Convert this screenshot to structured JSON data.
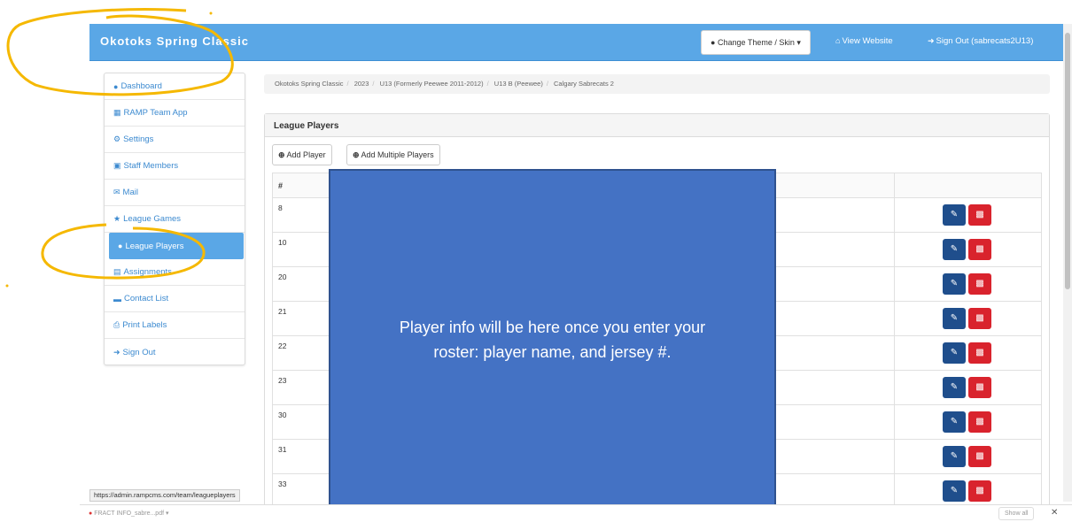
{
  "header": {
    "brand": "Okotoks Spring Classic",
    "theme_button": "Change Theme / Skin",
    "view_website": "View Website",
    "sign_out": "Sign Out (sabrecats2U13)"
  },
  "sidebar": {
    "items": [
      {
        "label": "Dashboard",
        "icon": "user-icon"
      },
      {
        "label": "RAMP Team App",
        "icon": "grid-icon"
      },
      {
        "label": "Settings",
        "icon": "gear-icon"
      },
      {
        "label": "Staff Members",
        "icon": "briefcase-icon"
      },
      {
        "label": "Mail",
        "icon": "envelope-icon"
      },
      {
        "label": "League Games",
        "icon": "star-icon"
      },
      {
        "label": "League Players",
        "icon": "user-icon"
      },
      {
        "label": "Assignments",
        "icon": "list-icon"
      },
      {
        "label": "Contact List",
        "icon": "comment-icon"
      },
      {
        "label": "Print Labels",
        "icon": "print-icon"
      },
      {
        "label": "Sign Out",
        "icon": "sign-out-icon"
      }
    ]
  },
  "breadcrumb": [
    "Okotoks Spring Classic",
    "2023",
    "U13 (Formerly Peewee 2011-2012)",
    "U13 B (Peewee)",
    "Calgary Sabrecats 2"
  ],
  "panel": {
    "title": "League Players",
    "add_player": "Add Player",
    "add_multiple": "Add Multiple Players",
    "column_number": "#",
    "rows": [
      "8",
      "10",
      "20",
      "21",
      "22",
      "23",
      "30",
      "31",
      "33"
    ]
  },
  "overlay": {
    "line1": "Player info will be here once you enter your",
    "line2": "roster: player name, and jersey #."
  },
  "status_url": "https://admin.rampcms.com/team/leagueplayers",
  "download_bar": {
    "file": "FRACT INFO_sabre...pdf",
    "show_all": "Show all"
  },
  "colors": {
    "navbar": "#5aa7e6",
    "edit_button": "#1f4e8c",
    "delete_button": "#d9232d",
    "overlay": "#4472c4",
    "annotation": "#f5b800"
  }
}
